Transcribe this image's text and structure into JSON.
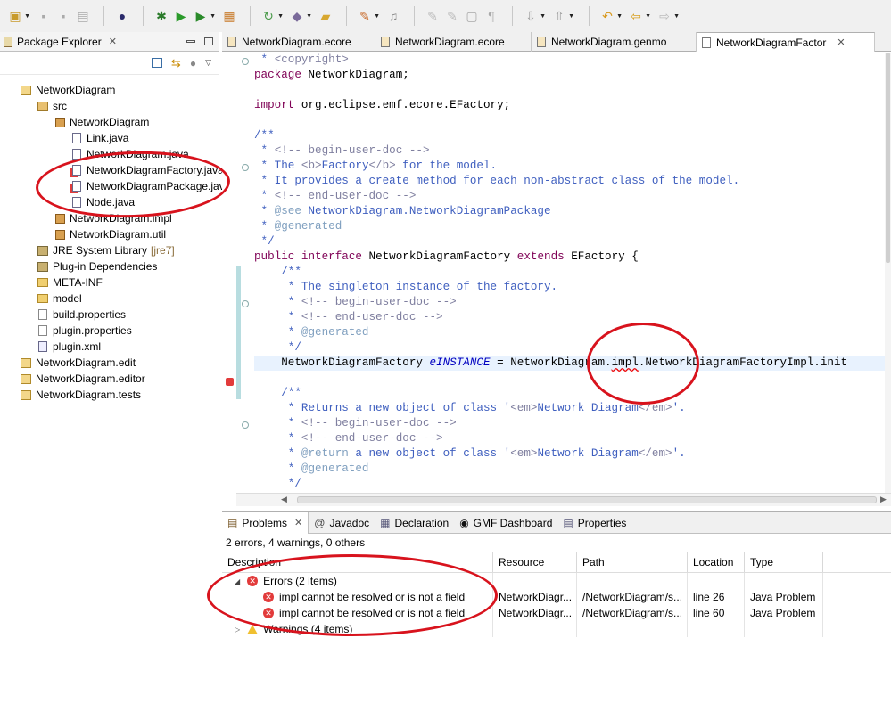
{
  "toolbar": {
    "icons": [
      "new-icon",
      "save-icon",
      "save-all-icon",
      "print-icon",
      "eclipse-icon",
      "debug-icon",
      "run-icon",
      "external-tools-icon",
      "new-package-icon",
      "refresh-icon",
      "open-type-icon",
      "open-folder-icon",
      "search-icon",
      "annotation-icon",
      "pen-icon",
      "pencil-icon",
      "block-icon",
      "pilcrow-icon",
      "next-annotation-icon",
      "prev-annotation-icon",
      "last-edit-icon",
      "back-icon",
      "forward-icon"
    ]
  },
  "package_explorer": {
    "title": "Package Explorer",
    "tree": [
      {
        "label": "NetworkDiagram",
        "depth": 0,
        "icon": "project-icon"
      },
      {
        "label": "src",
        "depth": 1,
        "icon": "source-folder-icon"
      },
      {
        "label": "NetworkDiagram",
        "depth": 2,
        "icon": "package-icon"
      },
      {
        "label": "Link.java",
        "depth": 3,
        "icon": "java-file-icon"
      },
      {
        "label": "NetworkDiagram.java",
        "depth": 3,
        "icon": "java-file-icon"
      },
      {
        "label": "NetworkDiagramFactory.java",
        "depth": 3,
        "icon": "java-file-error-icon"
      },
      {
        "label": "NetworkDiagramPackage.java",
        "depth": 3,
        "icon": "java-file-error-icon"
      },
      {
        "label": "Node.java",
        "depth": 3,
        "icon": "java-file-icon"
      },
      {
        "label": "NetworkDiagram.impl",
        "depth": 2,
        "icon": "package-icon"
      },
      {
        "label": "NetworkDiagram.util",
        "depth": 2,
        "icon": "package-icon"
      },
      {
        "label": "JRE System Library",
        "suffix": "[jre7]",
        "depth": 1,
        "icon": "library-icon"
      },
      {
        "label": "Plug-in Dependencies",
        "depth": 1,
        "icon": "library-icon"
      },
      {
        "label": "META-INF",
        "depth": 1,
        "icon": "folder-icon"
      },
      {
        "label": "model",
        "depth": 1,
        "icon": "folder-icon"
      },
      {
        "label": "build.properties",
        "depth": 1,
        "icon": "properties-file-icon"
      },
      {
        "label": "plugin.properties",
        "depth": 1,
        "icon": "properties-file-icon"
      },
      {
        "label": "plugin.xml",
        "depth": 1,
        "icon": "xml-file-icon"
      },
      {
        "label": "NetworkDiagram.edit",
        "depth": 0,
        "icon": "project-icon"
      },
      {
        "label": "NetworkDiagram.editor",
        "depth": 0,
        "icon": "project-icon"
      },
      {
        "label": "NetworkDiagram.tests",
        "depth": 0,
        "icon": "project-icon"
      }
    ]
  },
  "editor": {
    "tabs": [
      {
        "label": "NetworkDiagram.ecore",
        "active": false
      },
      {
        "label": "NetworkDiagram.ecore",
        "active": false
      },
      {
        "label": "NetworkDiagram.genmo",
        "active": false
      },
      {
        "label": "NetworkDiagramFactor",
        "active": true
      }
    ],
    "lines": [
      " * <copyright>",
      "package NetworkDiagram;",
      "",
      "import org.eclipse.emf.ecore.EFactory;",
      "",
      "/**",
      " * <!-- begin-user-doc -->",
      " * The <b>Factory</b> for the model.",
      " * It provides a create method for each non-abstract class of the model.",
      " * <!-- end-user-doc -->",
      " * @see NetworkDiagram.NetworkDiagramPackage",
      " * @generated",
      " */",
      "public interface NetworkDiagramFactory extends EFactory {",
      "    /**",
      "     * The singleton instance of the factory.",
      "     * <!-- begin-user-doc -->",
      "     * <!-- end-user-doc -->",
      "     * @generated",
      "     */",
      "    NetworkDiagramFactory eINSTANCE = NetworkDiagram.impl.NetworkDiagramFactoryImpl.init",
      "",
      "    /**",
      "     * Returns a new object of class '<em>Network Diagram</em>'.",
      "     * <!-- begin-user-doc -->",
      "     * <!-- end-user-doc -->",
      "     * @return a new object of class '<em>Network Diagram</em>'.",
      "     * @generated",
      "     */"
    ]
  },
  "problems": {
    "tabs": [
      {
        "label": "Problems",
        "icon": "problems-icon"
      },
      {
        "label": "Javadoc",
        "icon": "javadoc-icon"
      },
      {
        "label": "Declaration",
        "icon": "declaration-icon"
      },
      {
        "label": "GMF Dashboard",
        "icon": "gmf-dashboard-icon"
      },
      {
        "label": "Properties",
        "icon": "properties-icon"
      }
    ],
    "summary": "2 errors, 4 warnings, 0 others",
    "columns": [
      "Description",
      "Resource",
      "Path",
      "Location",
      "Type"
    ],
    "groups": [
      {
        "label": "Errors (2 items)",
        "kind": "error",
        "items": [
          {
            "description": "impl cannot be resolved or is not a field",
            "resource": "NetworkDiagr...",
            "path": "/NetworkDiagram/s...",
            "location": "line 26",
            "type": "Java Problem"
          },
          {
            "description": "impl cannot be resolved or is not a field",
            "resource": "NetworkDiagr...",
            "path": "/NetworkDiagram/s...",
            "location": "line 60",
            "type": "Java Problem"
          }
        ]
      },
      {
        "label": "Warnings (4 items)",
        "kind": "warning",
        "items": []
      }
    ]
  },
  "colors": {
    "annotation_red": "#d8131d",
    "keyword": "#7f0055",
    "javadoc": "#3f5fbf",
    "field": "#0000c0"
  }
}
